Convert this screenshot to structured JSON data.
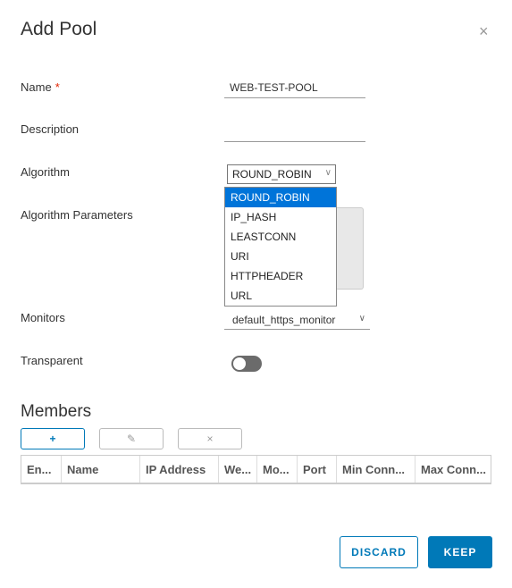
{
  "dialog": {
    "title": "Add Pool",
    "close_glyph": "×"
  },
  "form": {
    "name_label": "Name",
    "required_marker": "*",
    "name_value": "WEB-TEST-POOL",
    "description_label": "Description",
    "description_value": "",
    "algorithm_label": "Algorithm",
    "algorithm_value": "ROUND_ROBIN",
    "algorithm_options": [
      "ROUND_ROBIN",
      "IP_HASH",
      "LEASTCONN",
      "URI",
      "HTTPHEADER",
      "URL"
    ],
    "algorithm_params_label": "Algorithm Parameters",
    "monitors_label": "Monitors",
    "monitors_value": "default_https_monitor",
    "transparent_label": "Transparent",
    "transparent_enabled": false
  },
  "members": {
    "title": "Members",
    "add_glyph": "+",
    "edit_glyph": "✎",
    "delete_glyph": "×",
    "columns": [
      "En...",
      "Name",
      "IP Address",
      "We...",
      "Mo...",
      "Port",
      "Min Conn...",
      "Max Conn..."
    ]
  },
  "footer": {
    "discard_label": "DISCARD",
    "keep_label": "KEEP"
  },
  "colors": {
    "accent": "#0079b8",
    "selected": "#0074d9",
    "required": "#e12200"
  }
}
